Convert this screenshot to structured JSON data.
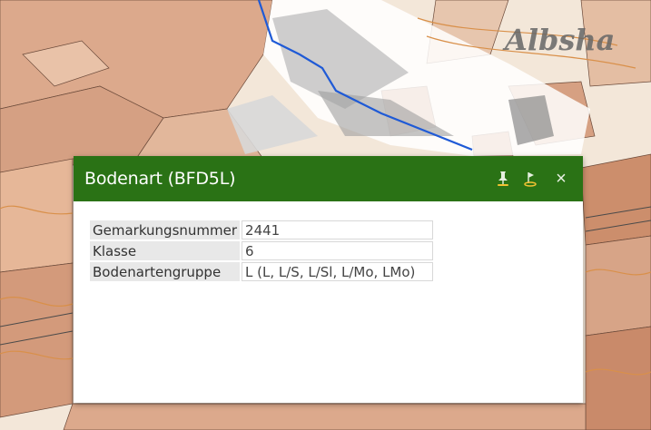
{
  "map": {
    "label": "Albsha",
    "colors": {
      "base": "#f3e7d9",
      "parcel": "#dca98c",
      "parcel_dark": "#c98a6a",
      "contour": "#d9904a",
      "river": "#1f5ad6",
      "road": "#ffffff"
    }
  },
  "popup": {
    "title": "Bodenart (BFD5L)",
    "header_color": "#2a7215",
    "buttons": {
      "pin": "pin-icon",
      "locate": "locate-icon",
      "close": "×"
    },
    "rows": [
      {
        "key": "Gemarkungsnummer",
        "value": "2441"
      },
      {
        "key": "Klasse",
        "value": "6"
      },
      {
        "key": "Bodenartengruppe",
        "value": "L (L, L/S, L/Sl, L/Mo, LMo)"
      }
    ]
  }
}
